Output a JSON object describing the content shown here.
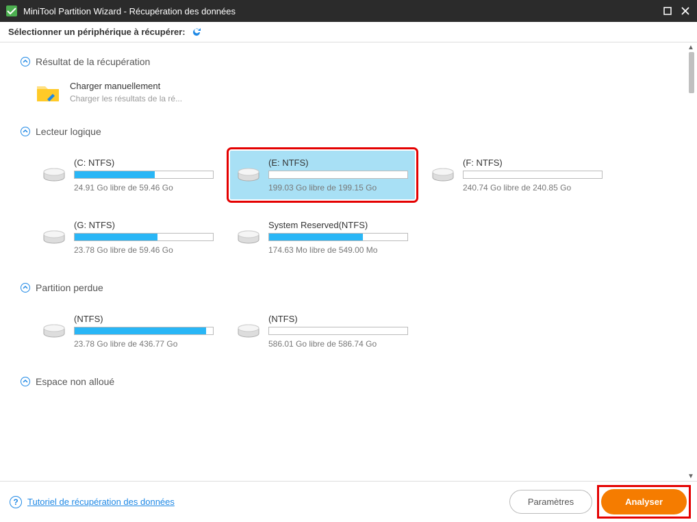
{
  "window": {
    "title": "MiniTool Partition Wizard - Récupération des données"
  },
  "subheader": {
    "label": "Sélectionner un périphérique à récupérer:"
  },
  "sections": {
    "recovery_result": {
      "title": "Résultat de la récupération",
      "manual": {
        "title": "Charger manuellement",
        "subtitle": "Charger les résultats de la ré..."
      }
    },
    "logical_drive": {
      "title": "Lecteur logique",
      "drives": [
        {
          "name": "(C: NTFS)",
          "free": "24.91 Go libre de 59.46 Go",
          "fill": 58,
          "selected": false,
          "highlighted": false
        },
        {
          "name": "(E: NTFS)",
          "free": "199.03 Go libre de 199.15 Go",
          "fill": 0,
          "selected": true,
          "highlighted": true
        },
        {
          "name": "(F: NTFS)",
          "free": "240.74 Go libre de 240.85 Go",
          "fill": 0,
          "selected": false,
          "highlighted": false
        },
        {
          "name": "(G: NTFS)",
          "free": "23.78 Go libre de 59.46 Go",
          "fill": 60,
          "selected": false,
          "highlighted": false
        },
        {
          "name": "System Reserved(NTFS)",
          "free": "174.63 Mo libre de 549.00 Mo",
          "fill": 68,
          "selected": false,
          "highlighted": false
        }
      ]
    },
    "lost_partition": {
      "title": "Partition perdue",
      "drives": [
        {
          "name": "(NTFS)",
          "free": "23.78 Go libre de 436.77 Go",
          "fill": 95,
          "selected": false,
          "highlighted": false
        },
        {
          "name": "(NTFS)",
          "free": "586.01 Go libre de 586.74 Go",
          "fill": 0,
          "selected": false,
          "highlighted": false
        }
      ]
    },
    "unallocated": {
      "title": "Espace non alloué"
    }
  },
  "footer": {
    "help_link": "Tutoriel de récupération des données",
    "settings": "Paramètres",
    "scan": "Analyser",
    "scan_highlighted": true
  }
}
